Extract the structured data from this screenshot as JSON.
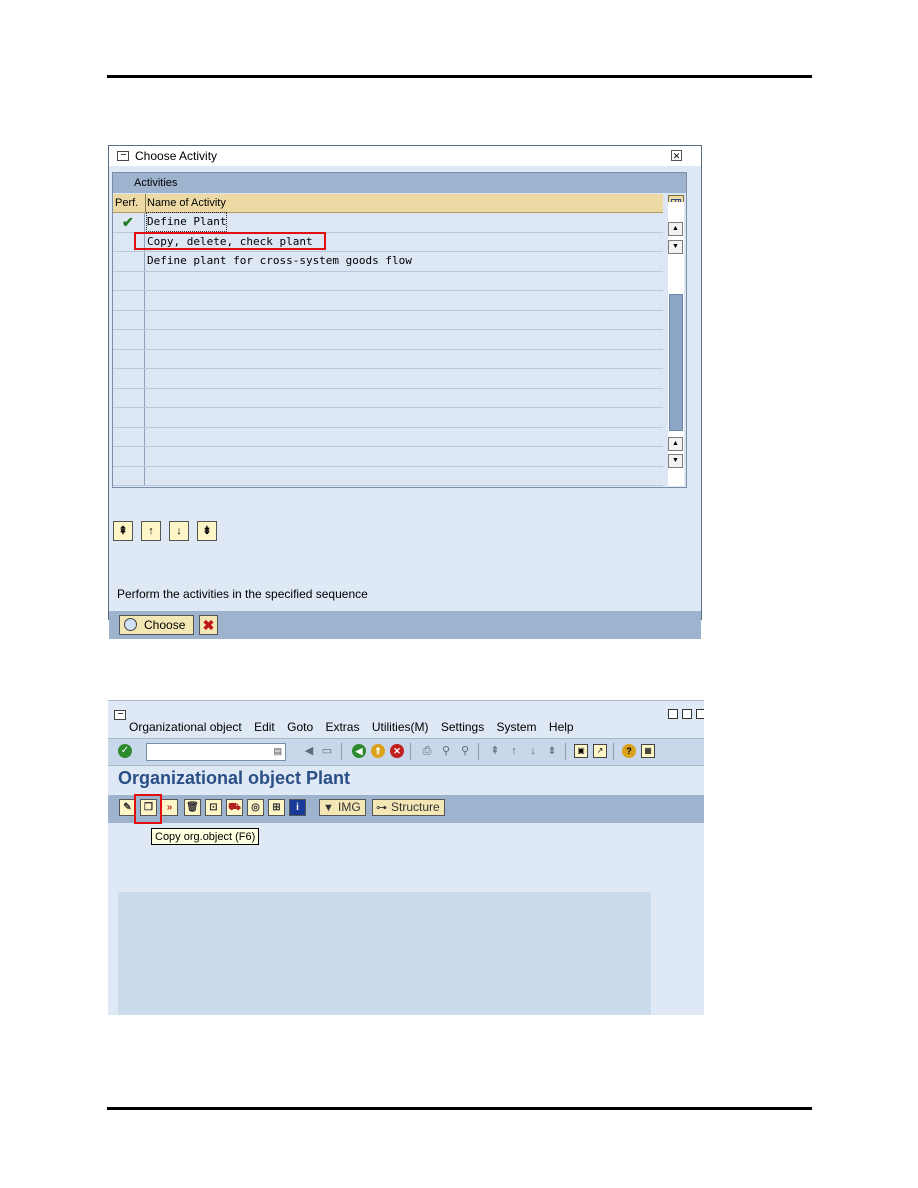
{
  "dialog": {
    "title": "Choose Activity",
    "table_caption": "Activities",
    "columns": [
      "Perf.",
      "Name of Activity"
    ],
    "rows": [
      {
        "performed": true,
        "name": "Define Plant"
      },
      {
        "performed": false,
        "name": "Copy, delete, check plant"
      },
      {
        "performed": false,
        "name": "Define plant for cross-system goods flow"
      }
    ],
    "hint": "Perform the activities in the specified sequence",
    "choose_label": "Choose"
  },
  "window2": {
    "menu": [
      "Organizational object",
      "Edit",
      "Goto",
      "Extras",
      "Utilities(M)",
      "Settings",
      "System",
      "Help"
    ],
    "page_title": "Organizational object Plant",
    "img_label": "IMG",
    "structure_label": "Structure",
    "tooltip": "Copy org.object  (F6)"
  },
  "colors": {
    "highlight": "#e01010",
    "title_blue": "#2a4e86",
    "sap_background": "#dfe9f5"
  }
}
